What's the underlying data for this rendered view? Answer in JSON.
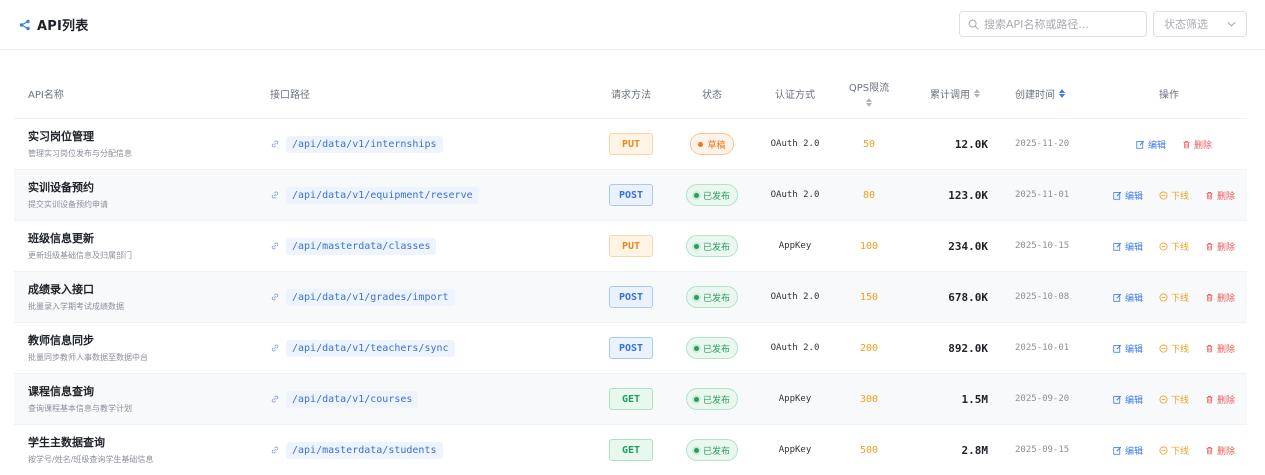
{
  "header": {
    "title": "API列表",
    "search_placeholder": "搜索API名称或路径...",
    "status_filter_placeholder": "状态筛选"
  },
  "columns": {
    "name": "API名称",
    "path": "接口路径",
    "method": "请求方法",
    "status": "状态",
    "auth": "认证方式",
    "qps": "QPS限流",
    "calls": "累计调用",
    "created": "创建时间",
    "actions": "操作"
  },
  "actions": {
    "edit": "编辑",
    "offline": "下线",
    "delete": "删除"
  },
  "rows": [
    {
      "name": "实习岗位管理",
      "desc": "管理实习岗位发布与分配信息",
      "path": "/api/data/v1/internships",
      "method": "PUT",
      "status": "草稿",
      "auth": "OAuth 2.0",
      "qps": "50",
      "calls": "12.0K",
      "created": "2025-11-20"
    },
    {
      "name": "实训设备预约",
      "desc": "提交实训设备预约申请",
      "path": "/api/data/v1/equipment/reserve",
      "method": "POST",
      "status": "已发布",
      "auth": "OAuth 2.0",
      "qps": "80",
      "calls": "123.0K",
      "created": "2025-11-01"
    },
    {
      "name": "班级信息更新",
      "desc": "更新班级基础信息及归属部门",
      "path": "/api/masterdata/classes",
      "method": "PUT",
      "status": "已发布",
      "auth": "AppKey",
      "qps": "100",
      "calls": "234.0K",
      "created": "2025-10-15"
    },
    {
      "name": "成绩录入接口",
      "desc": "批量录入学期考试成绩数据",
      "path": "/api/data/v1/grades/import",
      "method": "POST",
      "status": "已发布",
      "auth": "OAuth 2.0",
      "qps": "150",
      "calls": "678.0K",
      "created": "2025-10-08"
    },
    {
      "name": "教师信息同步",
      "desc": "批量同步教师人事数据至数据中台",
      "path": "/api/data/v1/teachers/sync",
      "method": "POST",
      "status": "已发布",
      "auth": "OAuth 2.0",
      "qps": "200",
      "calls": "892.0K",
      "created": "2025-10-01"
    },
    {
      "name": "课程信息查询",
      "desc": "查询课程基本信息与教学计划",
      "path": "/api/data/v1/courses",
      "method": "GET",
      "status": "已发布",
      "auth": "AppKey",
      "qps": "300",
      "calls": "1.5M",
      "created": "2025-09-20"
    },
    {
      "name": "学生主数据查询",
      "desc": "按学号/姓名/班级查询学生基础信息",
      "path": "/api/masterdata/students",
      "method": "GET",
      "status": "已发布",
      "auth": "AppKey",
      "qps": "500",
      "calls": "2.8M",
      "created": "2025-09-15"
    }
  ],
  "colors": {
    "accent": "#3b7ee8",
    "warning": "#f0a020",
    "danger": "#f05b5b",
    "success": "#2a9d5c"
  },
  "icons": {
    "title": "share-icon",
    "search": "search-icon",
    "select": "chevron-down-icon",
    "path": "link-icon",
    "edit": "edit-icon",
    "offline": "offline-circle-icon",
    "delete": "trash-icon"
  }
}
